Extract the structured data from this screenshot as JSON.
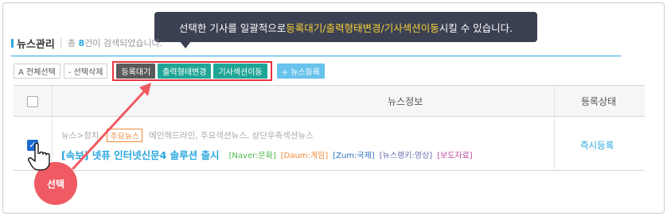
{
  "tooltip": {
    "prefix": "선택한 기사를 일괄적으로 ",
    "highlight": "등록대기/출력형태변경/기사섹션이동",
    "suffix": "시킬 수 있습니다."
  },
  "header": {
    "title": "뉴스관리",
    "separator": "|",
    "count_prefix": "총 ",
    "count_value": "8",
    "count_suffix": "건이 검색되었습니다."
  },
  "toolbar": {
    "select_all": "A 전체선택",
    "delete_selected": "- 선택삭제",
    "register_wait": "등록대기",
    "change_output": "출력형태변경",
    "move_section": "기사섹션이동",
    "register_news": "+ 뉴스등록"
  },
  "table": {
    "headers": {
      "news_info": "뉴스정보",
      "status": "등록상태"
    },
    "row": {
      "category_path": "뉴스>정치",
      "tag_main": "주요뉴스",
      "locations": "메인헤드라인, 주요섹션뉴스, 상단우측섹션뉴스",
      "title": "[속보] 넷퓨 인터넷신문4 솔루션 출시",
      "tags": [
        {
          "label": "[Naver:문화]",
          "color": "#4cb84c"
        },
        {
          "label": "[Daum:게임]",
          "color": "#f08a3b"
        },
        {
          "label": "[Zum:국제]",
          "color": "#2b6fc0"
        },
        {
          "label": "[뉴스랭키:영상]",
          "color": "#6a6fb0"
        },
        {
          "label": "[보도자료]",
          "color": "#c04fa0"
        }
      ],
      "status": "즉시등록",
      "checked": true
    }
  },
  "annotation": {
    "select_label": "선택"
  },
  "colors": {
    "accent": "#2aa8df",
    "highlight_border": "#e8333f",
    "tooltip_bg": "#3b4153",
    "badge": "#f05a62"
  }
}
